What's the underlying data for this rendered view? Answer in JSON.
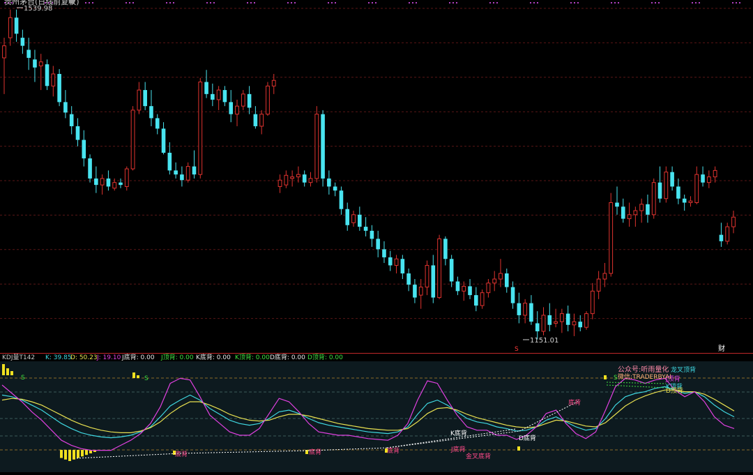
{
  "main_panel": {
    "title": "贵州茅台(日线前复权)",
    "high_label": "1539.98",
    "low_label": "1151.01",
    "signal_s": "S",
    "signal_cai": "财"
  },
  "indicator_panel": {
    "legend": [
      {
        "text": "KDJ量T142",
        "color": "#c8c8c8"
      },
      {
        "text": "K: 39.85",
        "color": "#3fd7e0"
      },
      {
        "text": "D: 50.23",
        "color": "#e8e050"
      },
      {
        "text": "J: 19.10",
        "color": "#e040e0"
      },
      {
        "text": "J底背: 0.00",
        "color": "#e8e8e8"
      },
      {
        "text": "J顶背: 0.00",
        "color": "#40e040"
      },
      {
        "text": "K底背: 0.00",
        "color": "#e8e8e8"
      },
      {
        "text": "K顶背: 0.00",
        "color": "#40e040"
      },
      {
        "text": "D底背: 0.00",
        "color": "#e8e8e8"
      },
      {
        "text": "D顶背: 0.00",
        "color": "#40e040"
      }
    ],
    "annotations": [
      {
        "text": "公众号:听雨量化",
        "color": "#ff8aa8"
      },
      {
        "text": "龙叉顶背",
        "color": "#3fd7e0"
      },
      {
        "text": "微信:TRADERBYAI",
        "color": "#ffb07a"
      },
      {
        "text": "J顶背",
        "color": "#e040e0"
      },
      {
        "text": "K顶背",
        "color": "#3fd7e0"
      },
      {
        "text": "D顶背",
        "color": "#e8e050"
      },
      {
        "text": "K底背",
        "color": "#ffffff"
      },
      {
        "text": "D底背",
        "color": "#ffffff"
      },
      {
        "text": "J底背",
        "color": "#ff4a8a"
      },
      {
        "text": "金叉底背",
        "color": "#ff4a8a"
      },
      {
        "text": "底背",
        "color": "#ff4a8a"
      },
      {
        "text": "S",
        "color": "#40e040"
      }
    ]
  },
  "chart_data": [
    {
      "type": "candlestick",
      "title": "贵州茅台(日线前复权)",
      "ylim_estimate": [
        1140,
        1545
      ],
      "annotations": [
        "1539.98",
        "1151.01"
      ],
      "ohlc": [
        [
          1480,
          1505,
          1435,
          1495
        ],
        [
          1505,
          1540,
          1495,
          1530
        ],
        [
          1530,
          1540,
          1500,
          1510
        ],
        [
          1505,
          1515,
          1485,
          1495
        ],
        [
          1490,
          1505,
          1465,
          1480
        ],
        [
          1478,
          1490,
          1450,
          1468
        ],
        [
          1470,
          1485,
          1440,
          1475
        ],
        [
          1472,
          1478,
          1440,
          1445
        ],
        [
          1445,
          1470,
          1432,
          1460
        ],
        [
          1460,
          1466,
          1420,
          1425
        ],
        [
          1425,
          1440,
          1405,
          1412
        ],
        [
          1410,
          1420,
          1385,
          1395
        ],
        [
          1395,
          1405,
          1370,
          1378
        ],
        [
          1378,
          1390,
          1345,
          1355
        ],
        [
          1355,
          1360,
          1325,
          1330
        ],
        [
          1330,
          1345,
          1312,
          1322
        ],
        [
          1322,
          1335,
          1310,
          1330
        ],
        [
          1330,
          1340,
          1315,
          1320
        ],
        [
          1318,
          1330,
          1315,
          1325
        ],
        [
          1325,
          1330,
          1318,
          1322
        ],
        [
          1320,
          1345,
          1315,
          1342
        ],
        [
          1342,
          1420,
          1340,
          1415
        ],
        [
          1415,
          1450,
          1410,
          1440
        ],
        [
          1440,
          1450,
          1415,
          1420
        ],
        [
          1420,
          1440,
          1395,
          1405
        ],
        [
          1405,
          1410,
          1385,
          1392
        ],
        [
          1392,
          1400,
          1360,
          1362
        ],
        [
          1362,
          1375,
          1335,
          1340
        ],
        [
          1340,
          1350,
          1330,
          1335
        ],
        [
          1335,
          1345,
          1320,
          1328
        ],
        [
          1328,
          1350,
          1325,
          1345
        ],
        [
          1345,
          1365,
          1330,
          1335
        ],
        [
          1335,
          1455,
          1330,
          1450
        ],
        [
          1450,
          1465,
          1430,
          1435
        ],
        [
          1435,
          1448,
          1420,
          1428
        ],
        [
          1428,
          1445,
          1415,
          1440
        ],
        [
          1440,
          1445,
          1420,
          1425
        ],
        [
          1425,
          1440,
          1400,
          1410
        ],
        [
          1410,
          1428,
          1395,
          1420
        ],
        [
          1420,
          1440,
          1415,
          1435
        ],
        [
          1435,
          1445,
          1410,
          1418
        ],
        [
          1410,
          1420,
          1392,
          1395
        ],
        [
          1395,
          1415,
          1385,
          1410
        ],
        [
          1410,
          1450,
          1408,
          1445
        ],
        [
          1445,
          1460,
          1435,
          1452
        ],
        [
          1320,
          1335,
          1312,
          1328
        ],
        [
          1322,
          1340,
          1318,
          1334
        ],
        [
          1330,
          1340,
          1320,
          1332
        ],
        [
          1332,
          1345,
          1325,
          1335
        ],
        [
          1335,
          1340,
          1320,
          1325
        ],
        [
          1325,
          1338,
          1320,
          1330
        ],
        [
          1330,
          1420,
          1325,
          1410
        ],
        [
          1410,
          1415,
          1320,
          1330
        ],
        [
          1330,
          1340,
          1310,
          1320
        ],
        [
          1320,
          1325,
          1308,
          1315
        ],
        [
          1315,
          1320,
          1285,
          1292
        ],
        [
          1292,
          1300,
          1265,
          1272
        ],
        [
          1275,
          1290,
          1270,
          1285
        ],
        [
          1285,
          1295,
          1265,
          1270
        ],
        [
          1270,
          1282,
          1258,
          1265
        ],
        [
          1265,
          1272,
          1245,
          1255
        ],
        [
          1255,
          1265,
          1232,
          1242
        ],
        [
          1242,
          1252,
          1225,
          1232
        ],
        [
          1232,
          1240,
          1215,
          1222
        ],
        [
          1222,
          1235,
          1212,
          1230
        ],
        [
          1230,
          1235,
          1205,
          1212
        ],
        [
          1212,
          1218,
          1190,
          1198
        ],
        [
          1198,
          1205,
          1175,
          1182
        ],
        [
          1185,
          1205,
          1168,
          1195
        ],
        [
          1195,
          1228,
          1185,
          1222
        ],
        [
          1222,
          1235,
          1175,
          1182
        ],
        [
          1182,
          1260,
          1180,
          1255
        ],
        [
          1255,
          1258,
          1222,
          1230
        ],
        [
          1230,
          1235,
          1195,
          1202
        ],
        [
          1202,
          1208,
          1185,
          1190
        ],
        [
          1190,
          1202,
          1178,
          1196
        ],
        [
          1196,
          1205,
          1180,
          1185
        ],
        [
          1185,
          1195,
          1165,
          1172
        ],
        [
          1172,
          1192,
          1168,
          1188
        ],
        [
          1188,
          1205,
          1182,
          1200
        ],
        [
          1200,
          1215,
          1190,
          1205
        ],
        [
          1205,
          1230,
          1195,
          1212
        ],
        [
          1212,
          1218,
          1188,
          1195
        ],
        [
          1195,
          1202,
          1168,
          1175
        ],
        [
          1175,
          1188,
          1150,
          1160
        ],
        [
          1160,
          1180,
          1150,
          1175
        ],
        [
          1175,
          1185,
          1148,
          1152
        ],
        [
          1150,
          1165,
          1130,
          1140
        ],
        [
          1140,
          1170,
          1135,
          1160
        ],
        [
          1160,
          1175,
          1140,
          1148
        ],
        [
          1150,
          1168,
          1145,
          1152
        ],
        [
          1152,
          1168,
          1138,
          1162
        ],
        [
          1162,
          1172,
          1140,
          1148
        ],
        [
          1148,
          1162,
          1134,
          1152
        ],
        [
          1152,
          1160,
          1140,
          1145
        ],
        [
          1145,
          1165,
          1142,
          1162
        ],
        [
          1162,
          1200,
          1155,
          1190
        ],
        [
          1190,
          1215,
          1180,
          1205
        ],
        [
          1205,
          1225,
          1195,
          1212
        ],
        [
          1212,
          1312,
          1208,
          1300
        ],
        [
          1300,
          1320,
          1285,
          1295
        ],
        [
          1295,
          1305,
          1275,
          1280
        ],
        [
          1280,
          1300,
          1270,
          1285
        ],
        [
          1285,
          1295,
          1270,
          1290
        ],
        [
          1290,
          1305,
          1275,
          1298
        ],
        [
          1298,
          1310,
          1275,
          1285
        ],
        [
          1285,
          1330,
          1280,
          1325
        ],
        [
          1325,
          1345,
          1300,
          1305
        ],
        [
          1305,
          1345,
          1300,
          1338
        ],
        [
          1338,
          1345,
          1315,
          1320
        ],
        [
          1320,
          1330,
          1298,
          1305
        ],
        [
          1305,
          1310,
          1290,
          1300
        ],
        [
          1300,
          1308,
          1295,
          1302
        ],
        [
          1300,
          1345,
          1298,
          1335
        ],
        [
          1335,
          1345,
          1320,
          1325
        ],
        [
          1325,
          1340,
          1318,
          1332
        ],
        [
          1332,
          1345,
          1325,
          1340
        ],
        [
          1260,
          1275,
          1245,
          1252
        ],
        [
          1252,
          1275,
          1248,
          1270
        ],
        [
          1270,
          1290,
          1262,
          1282
        ]
      ]
    },
    {
      "type": "line",
      "title": "KDJ量T142",
      "series": [
        {
          "name": "K",
          "values": [
            78,
            76,
            72,
            66,
            60,
            52,
            44,
            38,
            33,
            30,
            28,
            27,
            28,
            30,
            34,
            40,
            52,
            65,
            72,
            78,
            72,
            62,
            55,
            48,
            44,
            42,
            44,
            50,
            58,
            60,
            56,
            50,
            45,
            42,
            40,
            38,
            36,
            34,
            33,
            32,
            34,
            40,
            55,
            68,
            72,
            66,
            58,
            50,
            46,
            44,
            40,
            38,
            35,
            36,
            40,
            48,
            52,
            46,
            40,
            36,
            38,
            50,
            66,
            76,
            80,
            82,
            86,
            88,
            84,
            80,
            82,
            76,
            66,
            58,
            52
          ]
        },
        {
          "name": "D",
          "values": [
            72,
            74,
            73,
            70,
            66,
            60,
            54,
            48,
            43,
            39,
            36,
            34,
            33,
            33,
            35,
            39,
            46,
            56,
            64,
            70,
            70,
            66,
            61,
            55,
            51,
            48,
            47,
            48,
            52,
            55,
            55,
            53,
            50,
            47,
            44,
            42,
            40,
            38,
            37,
            36,
            36,
            38,
            46,
            56,
            62,
            63,
            60,
            55,
            51,
            48,
            45,
            42,
            40,
            39,
            40,
            44,
            48,
            47,
            44,
            41,
            40,
            45,
            55,
            65,
            72,
            77,
            81,
            84,
            84,
            82,
            82,
            79,
            73,
            66,
            59
          ]
        },
        {
          "name": "J",
          "values": [
            90,
            80,
            70,
            58,
            48,
            36,
            24,
            18,
            14,
            12,
            12,
            12,
            18,
            24,
            32,
            44,
            64,
            92,
            98,
            96,
            76,
            54,
            44,
            34,
            30,
            30,
            38,
            56,
            74,
            70,
            58,
            44,
            34,
            32,
            30,
            30,
            28,
            26,
            25,
            24,
            30,
            44,
            72,
            95,
            92,
            72,
            54,
            40,
            36,
            36,
            30,
            30,
            25,
            30,
            40,
            56,
            60,
            44,
            32,
            26,
            34,
            60,
            88,
            98,
            96,
            92,
            96,
            98,
            84,
            76,
            82,
            70,
            52,
            42,
            38
          ]
        }
      ]
    }
  ]
}
